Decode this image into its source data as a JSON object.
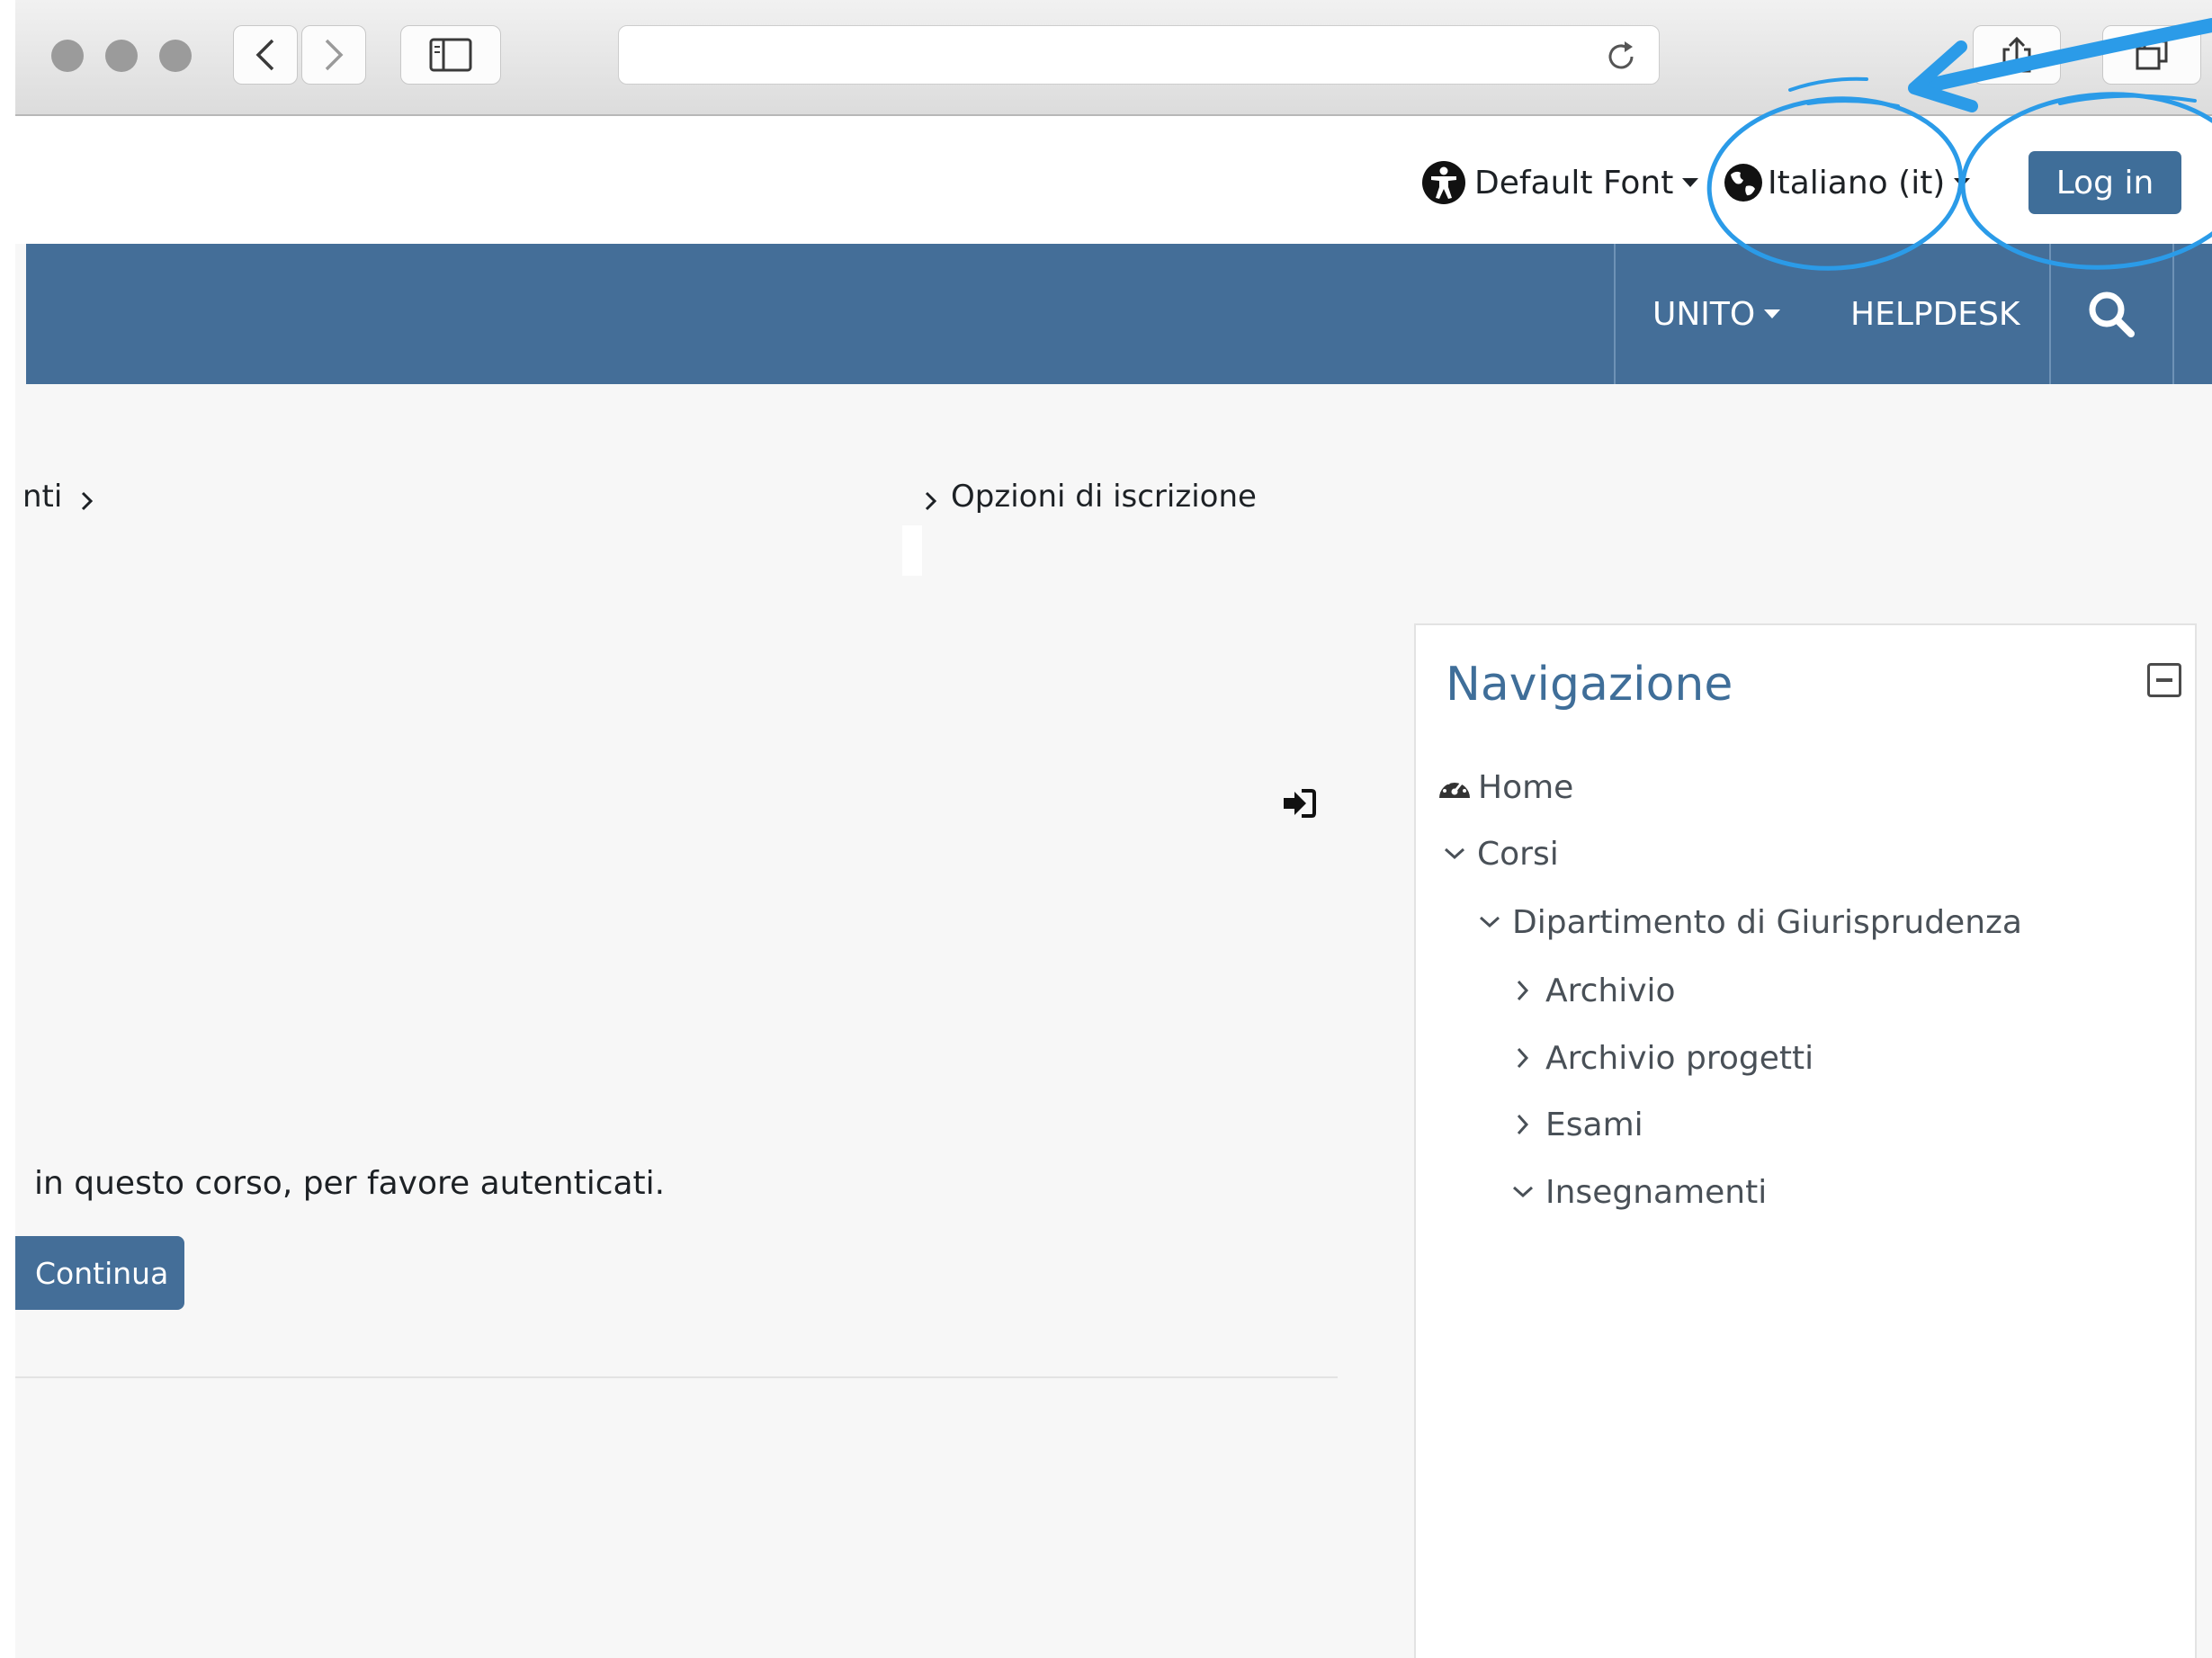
{
  "topbar": {
    "font_label": "Default Font",
    "language_label": "Italiano (it)",
    "login_label": "Log in"
  },
  "navbar": {
    "unito_label": "UNITO",
    "helpdesk_label": "HELPDESK"
  },
  "breadcrumb": {
    "partial_item": "nti",
    "current": "Opzioni di iscrizione"
  },
  "main": {
    "message": "in questo corso, per favore autenticati.",
    "continue_label": "Continua"
  },
  "navigation": {
    "title": "Navigazione",
    "items": [
      {
        "label": "Home",
        "icon": "dashboard-icon"
      },
      {
        "label": "Corsi",
        "state": "expanded"
      },
      {
        "label": "Dipartimento di Giurisprudenza",
        "state": "expanded"
      },
      {
        "label": "Archivio",
        "state": "collapsed"
      },
      {
        "label": "Archivio progetti",
        "state": "collapsed"
      },
      {
        "label": "Esami",
        "state": "collapsed"
      },
      {
        "label": "Insegnamenti",
        "state": "expanded"
      }
    ]
  },
  "colors": {
    "navbar": "#446e98",
    "primary_button": "#3f6e99",
    "annotation": "#2b9be8"
  }
}
